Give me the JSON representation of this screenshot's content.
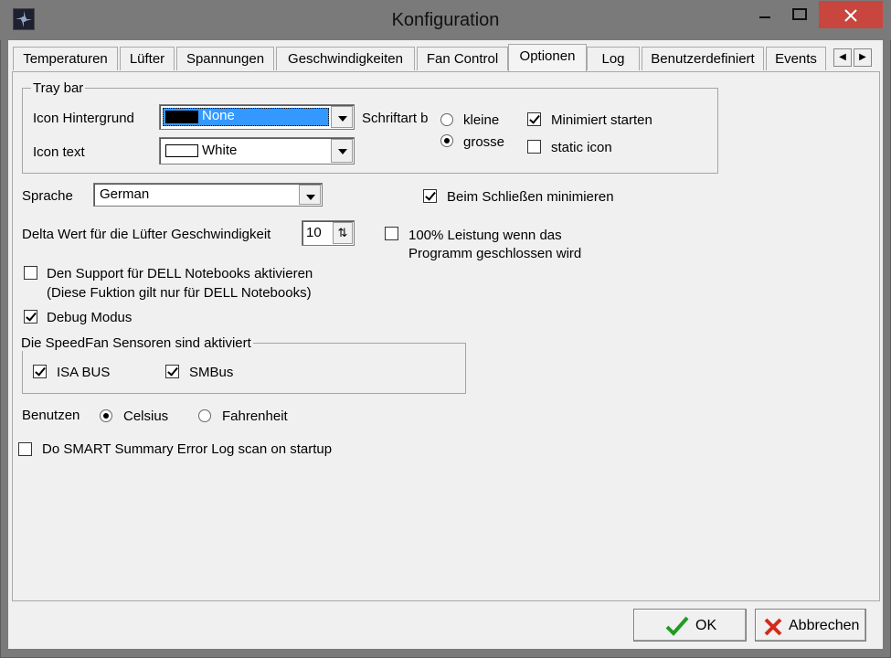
{
  "window": {
    "title": "Konfiguration"
  },
  "colors": {
    "close_button": "#c9463f",
    "selection": "#3399ff"
  },
  "tabs": [
    {
      "label": "Temperaturen"
    },
    {
      "label": "Lüfter"
    },
    {
      "label": "Spannungen"
    },
    {
      "label": "Geschwindigkeiten"
    },
    {
      "label": "Fan Control"
    },
    {
      "label": "Optionen",
      "active": true
    },
    {
      "label": "Log"
    },
    {
      "label": "Benutzerdefiniert"
    },
    {
      "label": "Events"
    }
  ],
  "tray_bar": {
    "group_label": "Tray bar",
    "icon_bg_label": "Icon Hintergrund",
    "icon_bg_value": "None",
    "icon_text_label": "Icon text",
    "icon_text_value": "White",
    "font_label": "Schriftart b",
    "font_small": "kleine",
    "font_large": "grosse",
    "font_selected": "grosse",
    "start_minimized": {
      "label": "Minimiert starten",
      "checked": true
    },
    "static_icon": {
      "label": "static icon",
      "checked": false
    }
  },
  "language": {
    "label": "Sprache",
    "value": "German"
  },
  "minimize_on_close": {
    "label": "Beim Schließen minimieren",
    "checked": true
  },
  "delta": {
    "label": "Delta Wert für die Lüfter Geschwindigkeit",
    "value": "10"
  },
  "full_power": {
    "label_line1": "100% Leistung wenn das",
    "label_line2": "Programm geschlossen wird",
    "checked": false
  },
  "dell": {
    "label_line1": "Den Support für DELL Notebooks aktivieren",
    "label_line2": "(Diese Fuktion gilt nur für DELL Notebooks)",
    "checked": false
  },
  "debug": {
    "label": "Debug Modus",
    "checked": true
  },
  "sensors": {
    "group_label": "Die SpeedFan Sensoren sind aktiviert",
    "isa": {
      "label": "ISA BUS",
      "checked": true
    },
    "smbus": {
      "label": "SMBus",
      "checked": true
    }
  },
  "units": {
    "label": "Benutzen",
    "celsius": "Celsius",
    "fahrenheit": "Fahrenheit",
    "selected": "Celsius"
  },
  "smart": {
    "label": "Do SMART Summary Error Log scan on startup",
    "checked": false
  },
  "buttons": {
    "ok": "OK",
    "cancel": "Abbrechen"
  }
}
